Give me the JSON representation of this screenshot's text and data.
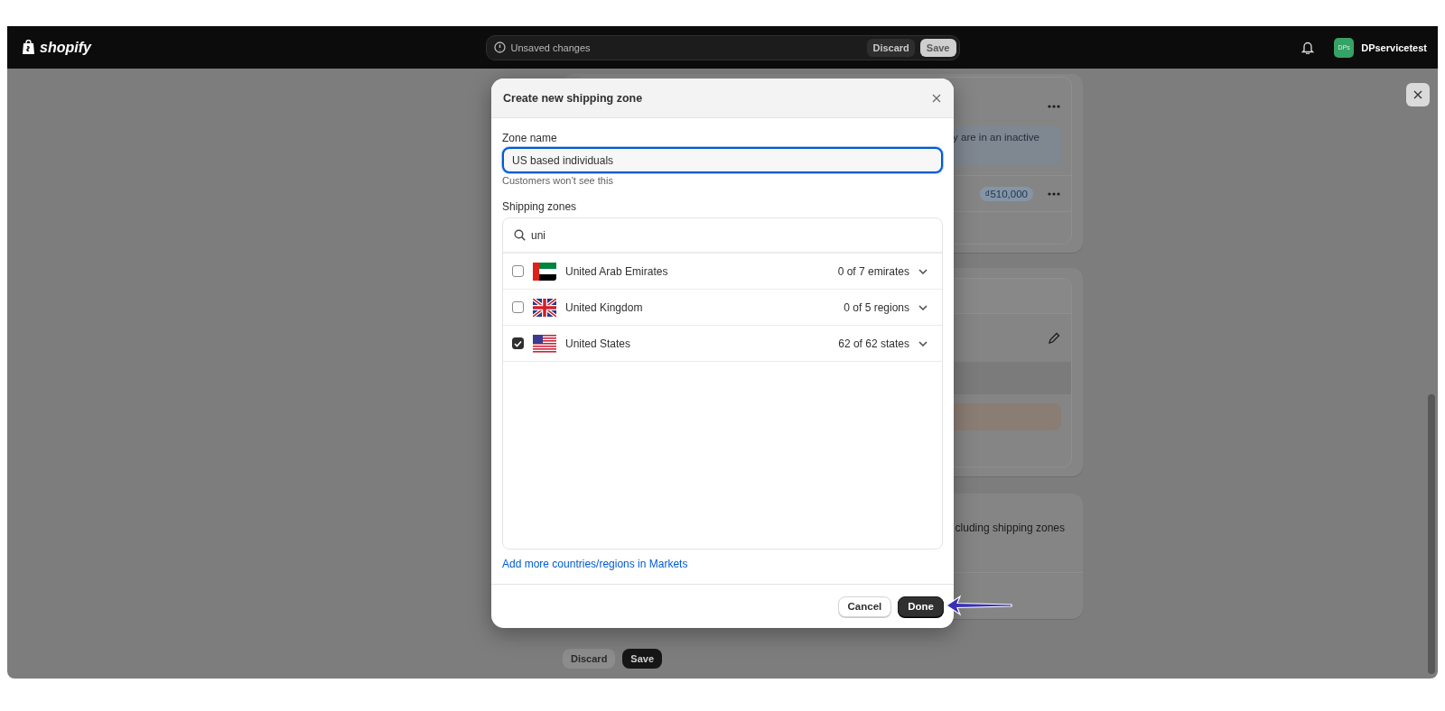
{
  "top_bar": {
    "logo": "shopify",
    "status": "Unsaved changes",
    "discard": "Discard",
    "save": "Save",
    "avatar_initials": "DPs",
    "store_name": "DPservicetest"
  },
  "background": {
    "banner_text": "y are in an inactive",
    "price_badge": "₫510,000",
    "footer_text": "cluding shipping zones",
    "buttons": [
      {
        "label": "Discard",
        "kind": "secondary"
      },
      {
        "label": "Save",
        "kind": "primary"
      }
    ]
  },
  "dialog": {
    "title": "Create new shipping zone",
    "zone_name": {
      "label": "Zone name",
      "value": "US based individuals",
      "help": "Customers won’t see this"
    },
    "shipping_zones": {
      "label": "Shipping zones",
      "search": {
        "value": "uni"
      },
      "countries": [
        {
          "name": "United Arab Emirates",
          "count": "0 of 7 emirates",
          "checked": false
        },
        {
          "name": "United Kingdom",
          "count": "0 of 5 regions",
          "checked": false
        },
        {
          "name": "United States",
          "count": "62 of 62 states",
          "checked": true
        }
      ]
    },
    "link": "Add more countries/regions in Markets",
    "buttons": [
      {
        "label": "Cancel",
        "kind": "secondary"
      },
      {
        "label": "Done",
        "kind": "primary"
      }
    ]
  }
}
